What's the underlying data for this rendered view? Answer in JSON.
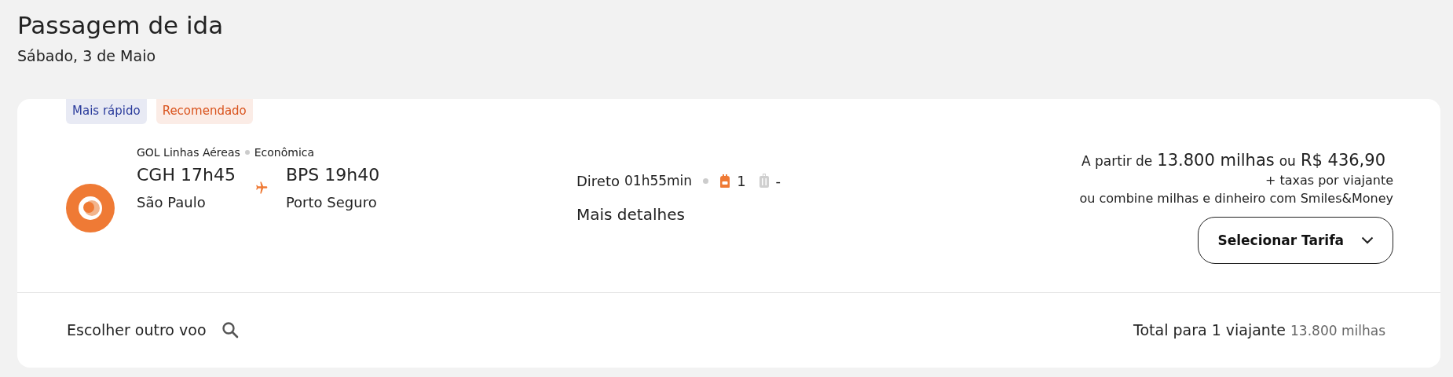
{
  "header": {
    "title": "Passagem de ida",
    "date": "Sábado, 3 de Maio"
  },
  "flight": {
    "tags": [
      {
        "label": "Mais rápido",
        "color": "#2b3c9c"
      },
      {
        "label": "Recomendado",
        "color": "#d9541e"
      }
    ],
    "airline": "GOL Linhas Aéreas",
    "cabin": "Econômica",
    "departure": {
      "code_time": "CGH 17h45",
      "city": "São Paulo"
    },
    "arrival": {
      "code_time": "BPS 19h40",
      "city": "Porto Seguro"
    },
    "stops": "Direto",
    "duration": "01h55min",
    "baggage": [
      {
        "kind": "carry-on",
        "count": "1",
        "included": true
      },
      {
        "kind": "checked",
        "count": "-",
        "included": false
      }
    ],
    "details_link": "Mais detalhes",
    "price": {
      "prefix": "A partir de",
      "miles": "13.800 milhas",
      "or": "ou",
      "money": "R$ 436,90",
      "taxes": "+ taxas por viajante",
      "combine": "ou combine milhas e dinheiro com Smiles&Money"
    },
    "select_button": "Selecionar Tarifa"
  },
  "footer": {
    "other_flight": "Escolher outro voo",
    "total_label": "Total para 1 viajante",
    "total_miles": "13.800 milhas"
  }
}
